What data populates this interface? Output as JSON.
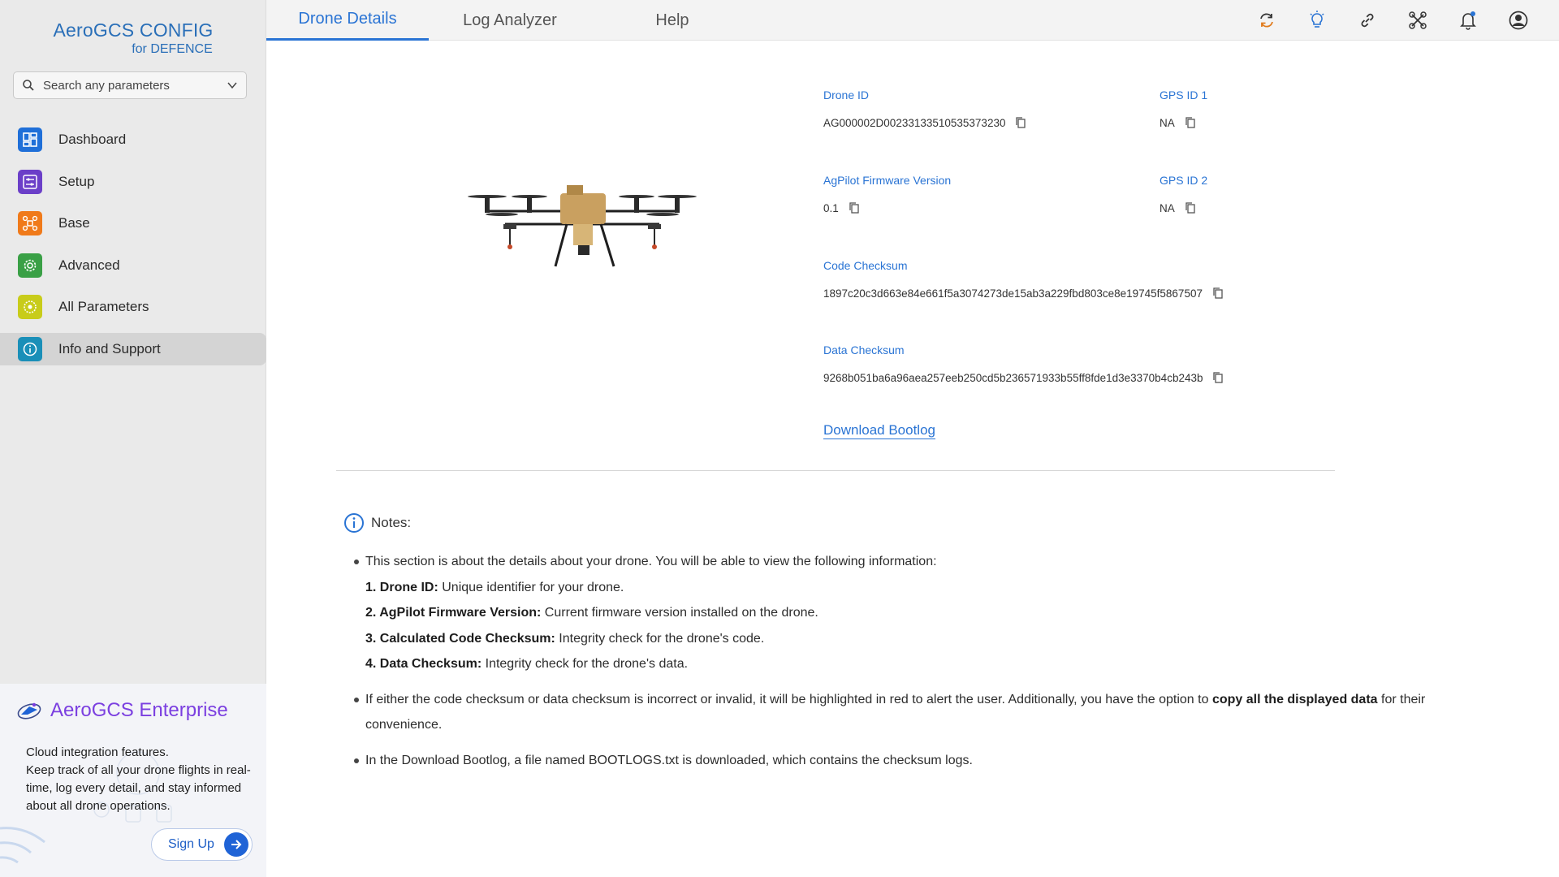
{
  "brand": {
    "title": "AeroGCS CONFIG",
    "subtitle": "for DEFENCE"
  },
  "search": {
    "placeholder": "Search any parameters"
  },
  "nav": [
    {
      "label": "Dashboard",
      "icon": "dashboard-icon",
      "color": "#1f6fd8"
    },
    {
      "label": "Setup",
      "icon": "setup-icon",
      "color": "#6b3fc8"
    },
    {
      "label": "Base",
      "icon": "base-icon",
      "color": "#f07a1a"
    },
    {
      "label": "Advanced",
      "icon": "advanced-icon",
      "color": "#3aa046"
    },
    {
      "label": "All Parameters",
      "icon": "all-parameters-icon",
      "color": "#c8cc1a"
    },
    {
      "label": "Info and Support",
      "icon": "info-icon",
      "color": "#1a8fb8",
      "active": true
    }
  ],
  "promo": {
    "title": "AeroGCS Enterprise",
    "text_line1": "Cloud integration features.",
    "text_line2": "Keep track of all your drone flights in real-time, log every detail, and stay informed about all drone operations.",
    "signup_label": "Sign Up"
  },
  "tabs": [
    {
      "label": "Drone Details",
      "active": true
    },
    {
      "label": "Log Analyzer"
    },
    {
      "label": "Help"
    }
  ],
  "toolbar_icons": [
    "sync-icon",
    "bulb-icon",
    "link-icon",
    "drone-icon",
    "bell-icon",
    "user-icon"
  ],
  "details": {
    "drone_id_label": "Drone ID",
    "drone_id_value": "AG000002D00233133510535373230",
    "gps1_label": "GPS ID 1",
    "gps1_value": "NA",
    "firmware_label": "AgPilot Firmware Version",
    "firmware_value": "0.1",
    "gps2_label": "GPS ID 2",
    "gps2_value": "NA",
    "code_checksum_label": "Code Checksum",
    "code_checksum_value": "1897c20c3d663e84e661f5a3074273de15ab3a229fbd803ce8e19745f5867507",
    "data_checksum_label": "Data Checksum",
    "data_checksum_value": "9268b051ba6a96aea257eeb250cd5b236571933b55ff8fde1d3e3370b4cb243b",
    "download_label": "Download Bootlog"
  },
  "notes": {
    "title": "Notes:",
    "b1": "This section is about the details about your drone. You will be able to view the following information:",
    "i1_bold": "1. Drone ID:",
    "i1_text": " Unique identifier for your drone.",
    "i2_bold": "2. AgPilot Firmware Version:",
    "i2_text": " Current firmware version installed on the drone.",
    "i3_bold": "3. Calculated Code Checksum:",
    "i3_text": " Integrity check for the drone's code.",
    "i4_bold": "4. Data Checksum:",
    "i4_text": " Integrity check for the drone's data.",
    "b2_pre": "If either the code checksum or data checksum is incorrect or invalid, it will be highlighted in red to alert the user. Additionally, you have the option to ",
    "b2_bold": "copy all the displayed data",
    "b2_post": " for their convenience.",
    "b3": "In the Download Bootlog, a file named BOOTLOGS.txt is downloaded, which contains the checksum logs."
  },
  "colors": {
    "accent": "#2a74d4",
    "brand": "#2a6fb8",
    "enterprise": "#7b3fe0"
  }
}
